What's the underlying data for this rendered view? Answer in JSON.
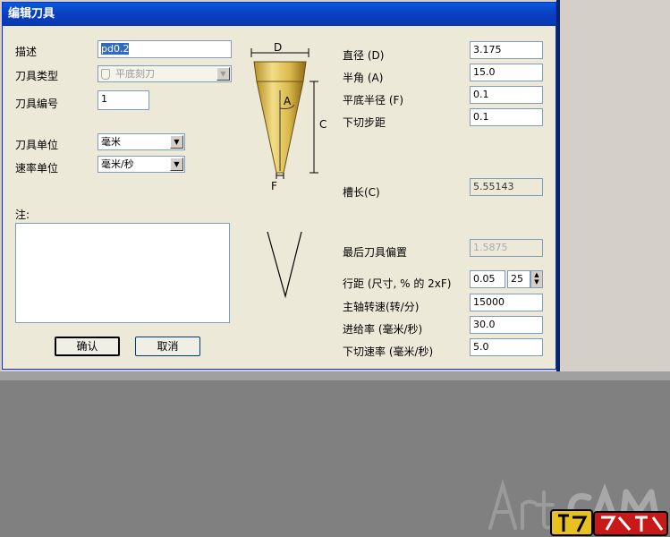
{
  "dialog": {
    "title": "编辑刀具"
  },
  "left": {
    "description_label": "描述",
    "description_value": "pd0.2",
    "tool_type_label": "刀具类型",
    "tool_type_value": "平底刻刀",
    "tool_number_label": "刀具编号",
    "tool_number_value": "1",
    "tool_unit_label": "刀具单位",
    "tool_unit_value": "毫米",
    "rate_unit_label": "速率单位",
    "rate_unit_value": "毫米/秒",
    "notes_label": "注:"
  },
  "diagram": {
    "label_d": "D",
    "label_a": "A",
    "label_c": "C",
    "label_f": "F"
  },
  "right": {
    "diameter_label": "直径 (D)",
    "diameter_value": "3.175",
    "half_angle_label": "半角 (A)",
    "half_angle_value": "15.0",
    "flat_radius_label": "平底半径 (F)",
    "flat_radius_value": "0.1",
    "stepdown_label": "下切步距",
    "stepdown_value": "0.1",
    "flute_length_label": "槽长(C)",
    "flute_length_value": "5.55143",
    "last_offset_label": "最后刀具偏置",
    "last_offset_value": "1.5875",
    "stepover_label": "行距 (尺寸, % 的 2xF)",
    "stepover_value": "0.05",
    "stepover_percent": "25",
    "spindle_label": "主轴转速(转/分)",
    "spindle_value": "15000",
    "feed_label": "进给率 (毫米/秒)",
    "feed_value": "30.0",
    "plunge_label": "下切速率 (毫米/秒)",
    "plunge_value": "5.0"
  },
  "buttons": {
    "ok": "确认",
    "cancel": "取消"
  },
  "colors": {
    "titlebar": "#0a3fc2",
    "dialog_bg": "#ece9d8",
    "tool_gold": "#d8b84a"
  }
}
